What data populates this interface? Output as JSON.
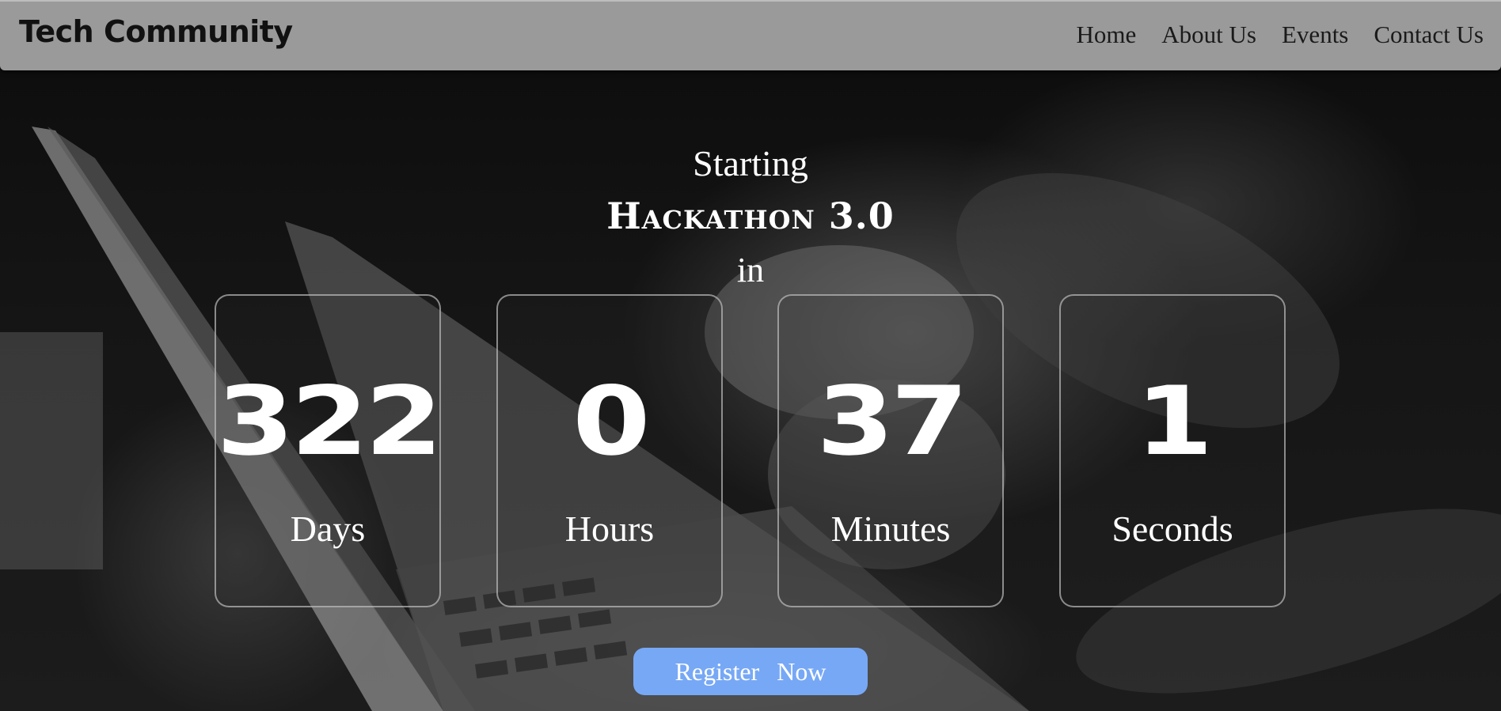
{
  "navbar": {
    "brand": "Tech Community",
    "links": [
      {
        "label": "Home"
      },
      {
        "label": "About Us"
      },
      {
        "label": "Events"
      },
      {
        "label": "Contact Us"
      }
    ]
  },
  "hero": {
    "prefix": "Starting",
    "event_title": "Hackathon 3.0",
    "suffix": "in",
    "background": "grayscale photo of hands typing on a laptop"
  },
  "countdown": [
    {
      "value": "322",
      "unit": "Days"
    },
    {
      "value": "0",
      "unit": "Hours"
    },
    {
      "value": "37",
      "unit": "Minutes"
    },
    {
      "value": "1",
      "unit": "Seconds"
    }
  ],
  "cta": {
    "label": "Register Now"
  },
  "colors": {
    "navbar_bg": "#9a9a9a",
    "button_bg": "#77a8f5",
    "text": "#ffffff"
  }
}
